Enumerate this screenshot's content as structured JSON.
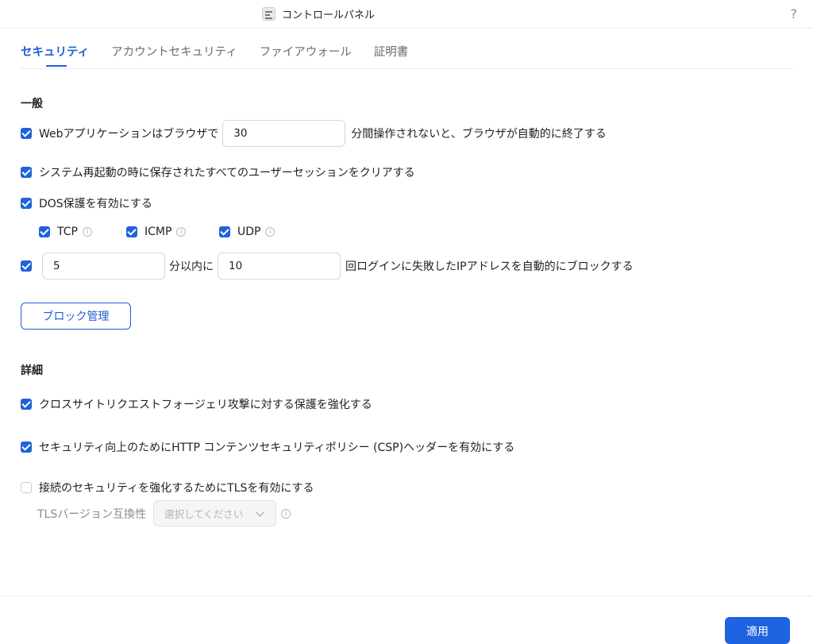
{
  "window": {
    "title": "コントロールパネル",
    "help_label": "?"
  },
  "tabs": [
    {
      "label": "セキュリティ",
      "active": true
    },
    {
      "label": "アカウントセキュリティ",
      "active": false
    },
    {
      "label": "ファイアウォール",
      "active": false
    },
    {
      "label": "証明書",
      "active": false
    }
  ],
  "general": {
    "heading": "一般",
    "session_timeout": {
      "checked": true,
      "label_before": "Webアプリケーションはブラウザで",
      "value": "30",
      "label_after": "分間操作されないと、ブラウザが自動的に終了する"
    },
    "clear_sessions": {
      "checked": true,
      "label": "システム再起動の時に保存されたすべてのユーザーセッションをクリアする"
    },
    "dos": {
      "checked": true,
      "label": "DOS保護を有効にする",
      "protocols": [
        {
          "label": "TCP",
          "checked": true
        },
        {
          "label": "ICMP",
          "checked": true
        },
        {
          "label": "UDP",
          "checked": true
        }
      ]
    },
    "auto_block": {
      "checked": true,
      "minutes_value": "5",
      "label_mid": "分以内に",
      "attempts_value": "10",
      "label_after": "回ログインに失敗したIPアドレスを自動的にブロックする"
    },
    "block_button": "ブロック管理"
  },
  "details": {
    "heading": "詳細",
    "csrf": {
      "checked": true,
      "label": "クロスサイトリクエストフォージェリ攻撃に対する保護を強化する"
    },
    "csp": {
      "checked": true,
      "label": "セキュリティ向上のためにHTTP コンテンツセキュリティポリシー (CSP)ヘッダーを有効にする"
    },
    "tls": {
      "checked": false,
      "label": "接続のセキュリティを強化するためにTLSを有効にする",
      "version_label": "TLSバージョン互換性",
      "select_placeholder": "選択してください"
    }
  },
  "footer": {
    "apply_label": "適用"
  },
  "colors": {
    "accent": "#1e63d8"
  }
}
